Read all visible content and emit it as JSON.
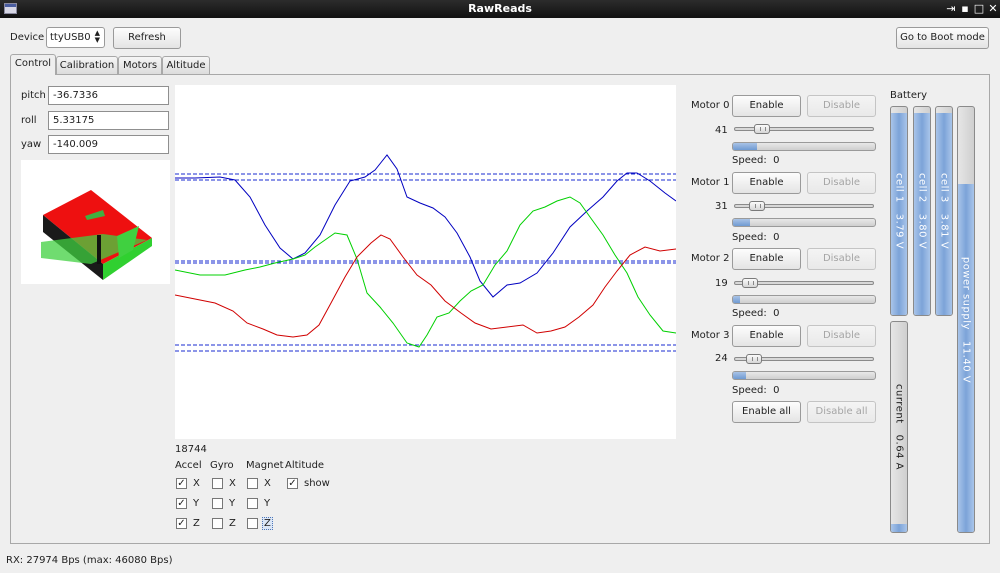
{
  "window": {
    "title": "RawReads"
  },
  "toolbar": {
    "device_label": "Device",
    "device_value": "ttyUSB0",
    "refresh_label": "Refresh",
    "boot_label": "Go to Boot mode"
  },
  "tabs": [
    "Control",
    "Calibration",
    "Motors",
    "Altitude"
  ],
  "attitude": {
    "pitch_label": "pitch",
    "pitch_value": "-36.7336",
    "roll_label": "roll",
    "roll_value": "5.33175",
    "yaw_label": "yaw",
    "yaw_value": "-140.009"
  },
  "plot": {
    "counter": "18744",
    "colors": {
      "blue": "#0000c0",
      "green": "#00d000",
      "red": "#d00000",
      "guide": "#1a2bd0"
    }
  },
  "sensors": {
    "headers": [
      "Accel",
      "Gyro",
      "Magnet",
      "Altitude"
    ],
    "axes": [
      "X",
      "Y",
      "Z"
    ],
    "accel_checked": [
      true,
      true,
      true
    ],
    "gyro_checked": [
      false,
      false,
      false
    ],
    "magnet_checked": [
      false,
      false,
      false
    ],
    "altitude_show_label": "show",
    "altitude_show_checked": true
  },
  "motors": {
    "enable_label": "Enable",
    "disable_label": "Disable",
    "speed_label": "Speed:",
    "items": [
      {
        "name": "Motor 0",
        "value": "41",
        "speed": "0",
        "slider_fraction": 0.2,
        "bar_fraction": 0.17
      },
      {
        "name": "Motor 1",
        "value": "31",
        "speed": "0",
        "slider_fraction": 0.15,
        "bar_fraction": 0.12
      },
      {
        "name": "Motor 2",
        "value": "19",
        "speed": "0",
        "slider_fraction": 0.1,
        "bar_fraction": 0.05
      },
      {
        "name": "Motor 3",
        "value": "24",
        "speed": "0",
        "slider_fraction": 0.12,
        "bar_fraction": 0.09
      }
    ],
    "enable_all_label": "Enable all",
    "disable_all_label": "Disable all"
  },
  "battery": {
    "title": "Battery",
    "cells": [
      {
        "name": "cell 1",
        "value": "3.79 V",
        "fraction": 0.97
      },
      {
        "name": "cell 2",
        "value": "3.80 V",
        "fraction": 0.97
      },
      {
        "name": "cell 3",
        "value": "3.81 V",
        "fraction": 0.97
      }
    ],
    "current": {
      "name": "current",
      "value": "0.64 A",
      "fraction": 0.04
    },
    "supply": {
      "name": "power supply",
      "value": "11.40 V",
      "fraction": 0.82
    }
  },
  "status": {
    "text": "RX: 27974 Bps (max: 46080 Bps)"
  }
}
